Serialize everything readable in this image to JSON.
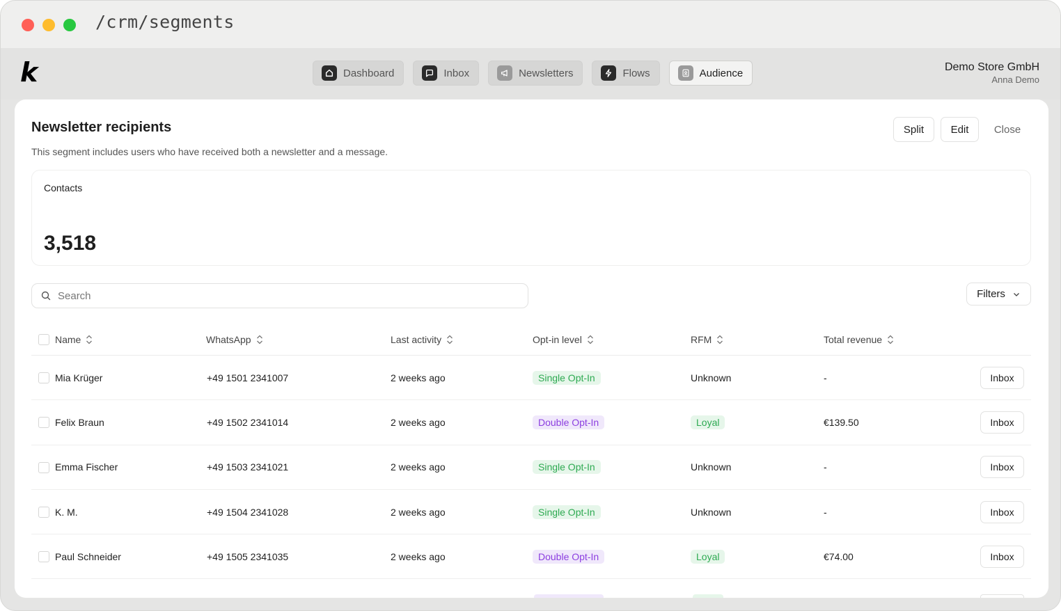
{
  "window": {
    "url": "/crm/segments"
  },
  "nav": {
    "items": [
      {
        "label": "Dashboard",
        "icon": "home-icon",
        "active": false
      },
      {
        "label": "Inbox",
        "icon": "chat-icon",
        "active": false
      },
      {
        "label": "Newsletters",
        "icon": "megaphone-icon",
        "active": false
      },
      {
        "label": "Flows",
        "icon": "lightning-icon",
        "active": false
      },
      {
        "label": "Audience",
        "icon": "contacts-icon",
        "active": true
      }
    ]
  },
  "account": {
    "store": "Demo Store GmbH",
    "user": "Anna Demo"
  },
  "logo": {
    "text": "k"
  },
  "segment": {
    "title": "Newsletter recipients",
    "description": "This segment includes users who have received both a newsletter and a message.",
    "actions": {
      "split": "Split",
      "edit": "Edit",
      "close": "Close"
    }
  },
  "stats": {
    "label": "Contacts",
    "value": "3,518"
  },
  "search": {
    "placeholder": "Search"
  },
  "filters": {
    "label": "Filters"
  },
  "table": {
    "columns": [
      "Name",
      "WhatsApp",
      "Last activity",
      "Opt-in level",
      "RFM",
      "Total revenue"
    ],
    "rows": [
      {
        "name": "Mia Krüger",
        "whatsapp": "+49 1501 2341007",
        "last_activity": "2 weeks ago",
        "optin": "Single Opt-In",
        "rfm": "Unknown",
        "revenue": "-",
        "action": "Inbox"
      },
      {
        "name": "Felix Braun",
        "whatsapp": "+49 1502 2341014",
        "last_activity": "2 weeks ago",
        "optin": "Double Opt-In",
        "rfm": "Loyal",
        "revenue": "€139.50",
        "action": "Inbox"
      },
      {
        "name": "Emma Fischer",
        "whatsapp": "+49 1503 2341021",
        "last_activity": "2 weeks ago",
        "optin": "Single Opt-In",
        "rfm": "Unknown",
        "revenue": "-",
        "action": "Inbox"
      },
      {
        "name": "K. M.",
        "whatsapp": "+49 1504 2341028",
        "last_activity": "2 weeks ago",
        "optin": "Single Opt-In",
        "rfm": "Unknown",
        "revenue": "-",
        "action": "Inbox"
      },
      {
        "name": "Paul Schneider",
        "whatsapp": "+49 1505 2341035",
        "last_activity": "2 weeks ago",
        "optin": "Double Opt-In",
        "rfm": "Loyal",
        "revenue": "€74.00",
        "action": "Inbox"
      }
    ]
  },
  "colors": {
    "single_optin_text": "#2eaa52",
    "double_optin_text": "#8c3fe0",
    "loyal_text": "#2eaa52"
  }
}
